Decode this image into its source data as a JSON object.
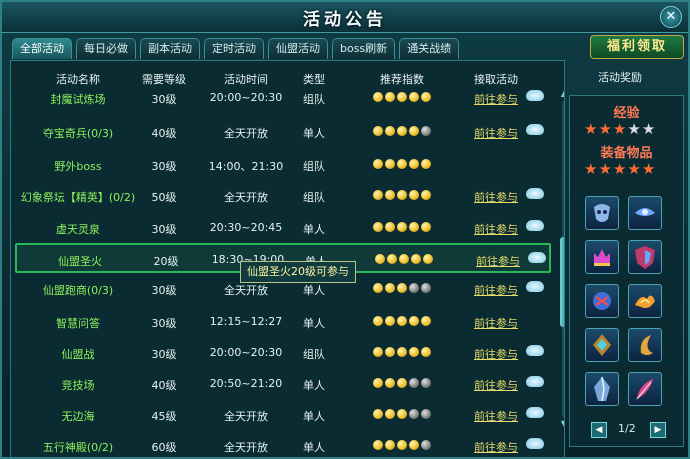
{
  "window": {
    "title": "活动公告",
    "close_icon": "close-icon"
  },
  "tabs": [
    {
      "label": "全部活动",
      "active": true
    },
    {
      "label": "每日必做",
      "active": false
    },
    {
      "label": "副本活动",
      "active": false
    },
    {
      "label": "定时活动",
      "active": false
    },
    {
      "label": "仙盟活动",
      "active": false
    },
    {
      "label": "boss刷新",
      "active": false
    },
    {
      "label": "通关战绩",
      "active": false
    }
  ],
  "welfare_button": "福利领取",
  "columns": {
    "name": "活动名称",
    "level": "需要等级",
    "time": "活动时间",
    "type": "类型",
    "rating": "推荐指数",
    "join": "接取活动",
    "reward": "活动奖励"
  },
  "activities": [
    {
      "name": "封魔试炼场",
      "level": "30级",
      "time": "20:00~20:30",
      "type": "组队",
      "rating": 5,
      "join": "前往参与",
      "cloud": true,
      "partial": "top"
    },
    {
      "name": "夺宝奇兵(0/3)",
      "level": "40级",
      "time": "全天开放",
      "type": "单人",
      "rating": 4,
      "join": "前往参与",
      "cloud": true
    },
    {
      "name": "野外boss",
      "level": "30级",
      "time": "14:00、21:30",
      "type": "组队",
      "rating": 5,
      "join": "",
      "cloud": false
    },
    {
      "name": "幻象祭坛【精英】(0/2)",
      "level": "50级",
      "time": "全天开放",
      "type": "组队",
      "rating": 5,
      "join": "前往参与",
      "cloud": true
    },
    {
      "name": "虚天灵泉",
      "level": "30级",
      "time": "20:30~20:45",
      "type": "单人",
      "rating": 5,
      "join": "前往参与",
      "cloud": true
    },
    {
      "name": "仙盟圣火",
      "level": "20级",
      "time": "18:30~19:00",
      "type": "单人",
      "rating": 5,
      "join": "前往参与",
      "cloud": true,
      "selected": true
    },
    {
      "name": "仙盟跑商(0/3)",
      "level": "30级",
      "time": "全天开放",
      "type": "单人",
      "rating": 3,
      "join": "前往参与",
      "cloud": true
    },
    {
      "name": "智慧问答",
      "level": "30级",
      "time": "12:15~12:27",
      "type": "单人",
      "rating": 5,
      "join": "前往参与",
      "cloud": false
    },
    {
      "name": "仙盟战",
      "level": "30级",
      "time": "20:00~20:30",
      "type": "组队",
      "rating": 5,
      "join": "前往参与",
      "cloud": true
    },
    {
      "name": "竞技场",
      "level": "40级",
      "time": "20:50~21:20",
      "type": "单人",
      "rating": 3,
      "join": "前往参与",
      "cloud": true
    },
    {
      "name": "无边海",
      "level": "45级",
      "time": "全天开放",
      "type": "单人",
      "rating": 3,
      "join": "前往参与",
      "cloud": true
    },
    {
      "name": "五行神殿(0/2)",
      "level": "60级",
      "time": "全天开放",
      "type": "单人",
      "rating": 4,
      "join": "前往参与",
      "cloud": true,
      "partial": "bottom"
    }
  ],
  "tooltip": "仙盟圣火20级可参与",
  "reward": {
    "exp_label": "经验",
    "exp_stars": 3,
    "item_label": "装备物品",
    "item_stars": 5,
    "icons": [
      "mask-icon",
      "gem-icon",
      "crown-icon",
      "shield-icon",
      "spirit-icon",
      "flame-icon",
      "rune-icon",
      "crescent-icon",
      "crystal-icon",
      "feather-icon"
    ],
    "page": "1/2"
  }
}
